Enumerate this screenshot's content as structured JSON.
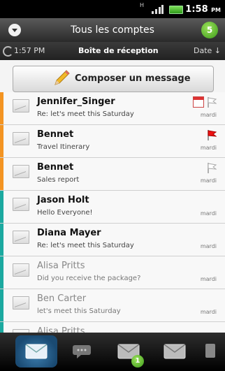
{
  "status_bar": {
    "network": "H",
    "time": "1:58",
    "ampm": "PM"
  },
  "header": {
    "account_title": "Tous les comptes",
    "unread_count": "5"
  },
  "sub_header": {
    "last_sync": "1:57 PM",
    "folder": "Boîte de réception",
    "sort_label": "Date ↓"
  },
  "compose": {
    "label": "Composer un message"
  },
  "colors": {
    "orange_bar": "#f39422",
    "teal_bar": "#1ba9a0",
    "accent_green": "#6fcc34"
  },
  "messages": [
    {
      "sender": "Jennifer_Singer",
      "subject": "Re: let's meet this Saturday",
      "date": "mardi",
      "state": "unread",
      "bar": "orange",
      "flag": "none",
      "icons": [
        "calendar-icon",
        "flag-outline-icon"
      ]
    },
    {
      "sender": "Bennet",
      "subject": "Travel Itinerary",
      "date": "mardi",
      "state": "unread",
      "bar": "orange",
      "flag": "red",
      "icons": [
        "flag-red-icon"
      ]
    },
    {
      "sender": "Bennet",
      "subject": "Sales report",
      "date": "mardi",
      "state": "unread",
      "bar": "orange",
      "flag": "outline",
      "icons": [
        "flag-outline-icon"
      ]
    },
    {
      "sender": "Jason Holt",
      "subject": "Hello Everyone!",
      "date": "mardi",
      "state": "unread",
      "bar": "teal",
      "flag": "none",
      "icons": []
    },
    {
      "sender": "Diana Mayer",
      "subject": "Re: let's meet this Saturday",
      "date": "mardi",
      "state": "unread",
      "bar": "teal",
      "flag": "none",
      "icons": []
    },
    {
      "sender": "Alisa Pritts",
      "subject": "Did you receive the package?",
      "date": "mardi",
      "state": "read",
      "bar": "teal",
      "flag": "none",
      "icons": []
    },
    {
      "sender": "Ben Carter",
      "subject": "let's meet this Saturday",
      "date": "mardi",
      "state": "read",
      "bar": "teal",
      "flag": "none",
      "icons": []
    },
    {
      "sender": "Alisa Pritts",
      "subject": "",
      "date": "",
      "state": "read",
      "bar": "teal",
      "flag": "none",
      "icons": []
    }
  ],
  "bottom_nav": {
    "tabs": [
      {
        "icon": "inbox-envelope-icon",
        "active": true
      },
      {
        "icon": "conversation-icon",
        "active": false
      },
      {
        "icon": "envelope-badge-icon",
        "active": false,
        "badge": "1"
      },
      {
        "icon": "envelope-icon",
        "active": false
      },
      {
        "icon": "more-icon",
        "active": false
      }
    ]
  }
}
